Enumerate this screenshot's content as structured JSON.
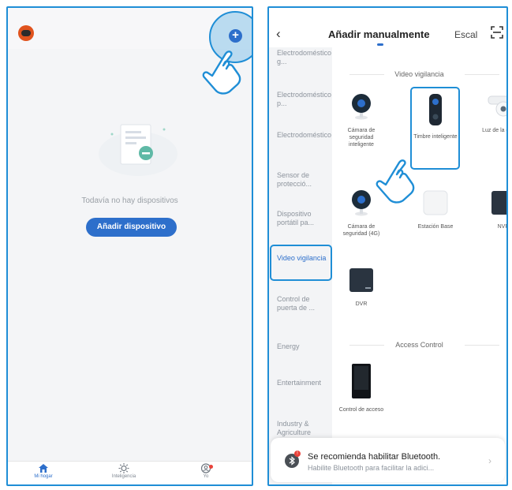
{
  "left": {
    "empty_text": "Todavía no hay dispositivos",
    "add_device_label": "Añadir dispositivo",
    "tabs": [
      {
        "label": "Mi hogar",
        "icon": "home-icon",
        "active": true
      },
      {
        "label": "Inteligencia",
        "icon": "sun-icon",
        "active": false
      },
      {
        "label": "Yo",
        "icon": "profile-icon",
        "active": false
      }
    ]
  },
  "right": {
    "back_icon": "‹",
    "title": "Añadir manualmente",
    "tab2": "Escal",
    "categories": [
      "Electrodoméstico g...",
      "Electrodoméstico p...",
      "Electrodoméstico",
      "Sensor de protecció...",
      "Dispositivo portátil pa...",
      "Video vigilancia",
      "Control de puerta de ...",
      "Energy",
      "Entertainment",
      "Industry & Agriculture"
    ],
    "active_category_index": 5,
    "sections": [
      {
        "title": "Video vigilancia",
        "items": [
          {
            "label": "Cámara de seguridad inteligente",
            "icon": "camera-icon"
          },
          {
            "label": "Timbre inteligente",
            "icon": "doorbell-icon"
          },
          {
            "label": "Luz de la cámara",
            "icon": "camera-light-icon"
          },
          {
            "label": "Cámara de seguridad (4G)",
            "icon": "camera-4g-icon"
          },
          {
            "label": "Estación Base",
            "icon": "base-station-icon"
          },
          {
            "label": "NVR",
            "icon": "nvr-icon"
          },
          {
            "label": "DVR",
            "icon": "dvr-icon"
          }
        ]
      },
      {
        "title": "Access Control",
        "items": [
          {
            "label": "Control de acceso",
            "icon": "access-control-icon"
          }
        ]
      }
    ],
    "bluetooth": {
      "title": "Se recomienda habilitar Bluetooth.",
      "subtitle": "Habilite Bluetooth para facilitar la adici...",
      "badge": "!",
      "arrow": "›"
    }
  },
  "colors": {
    "accent": "#2d6fcb",
    "highlight": "#1f8ed6",
    "avatar": "#e0531e",
    "alert": "#e9423a"
  }
}
